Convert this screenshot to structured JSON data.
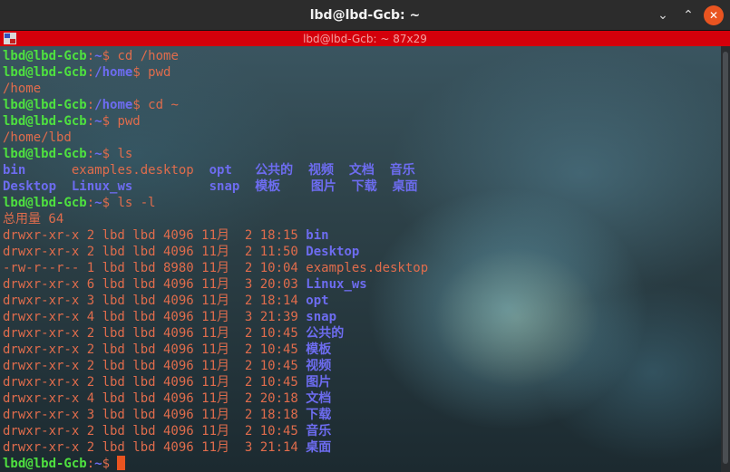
{
  "window": {
    "title": "lbd@lbd-Gcb: ~",
    "terminal_title": "lbd@lbd-Gcb: ~ 87x29"
  },
  "colors": {
    "prompt_user": "#4ee03f",
    "prompt_path": "#6d6cf0",
    "text": "#e06c4c",
    "directory": "#6d6cf0",
    "header_bar": "#d4000b",
    "cursor": "#e95420"
  },
  "terminal": {
    "lines": [
      [
        {
          "t": "lbd@lbd-Gcb",
          "s": "u"
        },
        {
          "t": ":",
          "s": "c"
        },
        {
          "t": "~",
          "s": "p"
        },
        {
          "t": "$ cd /home",
          "s": "c"
        }
      ],
      [
        {
          "t": "lbd@lbd-Gcb",
          "s": "u"
        },
        {
          "t": ":",
          "s": "c"
        },
        {
          "t": "/home",
          "s": "p"
        },
        {
          "t": "$ pwd",
          "s": "c"
        }
      ],
      [
        {
          "t": "/home",
          "s": "c"
        }
      ],
      [
        {
          "t": "lbd@lbd-Gcb",
          "s": "u"
        },
        {
          "t": ":",
          "s": "c"
        },
        {
          "t": "/home",
          "s": "p"
        },
        {
          "t": "$ cd ~",
          "s": "c"
        }
      ],
      [
        {
          "t": "lbd@lbd-Gcb",
          "s": "u"
        },
        {
          "t": ":",
          "s": "c"
        },
        {
          "t": "~",
          "s": "p"
        },
        {
          "t": "$ pwd",
          "s": "c"
        }
      ],
      [
        {
          "t": "/home/lbd",
          "s": "c"
        }
      ],
      [
        {
          "t": "lbd@lbd-Gcb",
          "s": "u"
        },
        {
          "t": ":",
          "s": "c"
        },
        {
          "t": "~",
          "s": "p"
        },
        {
          "t": "$ ls",
          "s": "c"
        }
      ],
      [
        {
          "t": "bin",
          "s": "d"
        },
        {
          "t": "      ",
          "s": "c"
        },
        {
          "t": "examples.desktop",
          "s": "c"
        },
        {
          "t": "  ",
          "s": "c"
        },
        {
          "t": "opt",
          "s": "d"
        },
        {
          "t": "   ",
          "s": "c"
        },
        {
          "t": "公共的",
          "s": "d"
        },
        {
          "t": "  ",
          "s": "c"
        },
        {
          "t": "视频",
          "s": "d"
        },
        {
          "t": "  ",
          "s": "c"
        },
        {
          "t": "文档",
          "s": "d"
        },
        {
          "t": "  ",
          "s": "c"
        },
        {
          "t": "音乐",
          "s": "d"
        }
      ],
      [
        {
          "t": "Desktop",
          "s": "d"
        },
        {
          "t": "  ",
          "s": "c"
        },
        {
          "t": "Linux_ws",
          "s": "d"
        },
        {
          "t": "          ",
          "s": "c"
        },
        {
          "t": "snap",
          "s": "d"
        },
        {
          "t": "  ",
          "s": "c"
        },
        {
          "t": "模板",
          "s": "d"
        },
        {
          "t": "    ",
          "s": "c"
        },
        {
          "t": "图片",
          "s": "d"
        },
        {
          "t": "  ",
          "s": "c"
        },
        {
          "t": "下载",
          "s": "d"
        },
        {
          "t": "  ",
          "s": "c"
        },
        {
          "t": "桌面",
          "s": "d"
        }
      ],
      [
        {
          "t": "lbd@lbd-Gcb",
          "s": "u"
        },
        {
          "t": ":",
          "s": "c"
        },
        {
          "t": "~",
          "s": "p"
        },
        {
          "t": "$ ls -l",
          "s": "c"
        }
      ],
      [
        {
          "t": "总用量 64",
          "s": "c"
        }
      ],
      [
        {
          "t": "drwxr-xr-x 2 lbd lbd 4096 11月  2 18:15 ",
          "s": "c"
        },
        {
          "t": "bin",
          "s": "d"
        }
      ],
      [
        {
          "t": "drwxr-xr-x 2 lbd lbd 4096 11月  2 11:50 ",
          "s": "c"
        },
        {
          "t": "Desktop",
          "s": "d"
        }
      ],
      [
        {
          "t": "-rw-r--r-- 1 lbd lbd 8980 11月  2 10:04 examples.desktop",
          "s": "c"
        }
      ],
      [
        {
          "t": "drwxr-xr-x 6 lbd lbd 4096 11月  3 20:03 ",
          "s": "c"
        },
        {
          "t": "Linux_ws",
          "s": "d"
        }
      ],
      [
        {
          "t": "drwxr-xr-x 3 lbd lbd 4096 11月  2 18:14 ",
          "s": "c"
        },
        {
          "t": "opt",
          "s": "d"
        }
      ],
      [
        {
          "t": "drwxr-xr-x 4 lbd lbd 4096 11月  3 21:39 ",
          "s": "c"
        },
        {
          "t": "snap",
          "s": "d"
        }
      ],
      [
        {
          "t": "drwxr-xr-x 2 lbd lbd 4096 11月  2 10:45 ",
          "s": "c"
        },
        {
          "t": "公共的",
          "s": "d"
        }
      ],
      [
        {
          "t": "drwxr-xr-x 2 lbd lbd 4096 11月  2 10:45 ",
          "s": "c"
        },
        {
          "t": "模板",
          "s": "d"
        }
      ],
      [
        {
          "t": "drwxr-xr-x 2 lbd lbd 4096 11月  2 10:45 ",
          "s": "c"
        },
        {
          "t": "视频",
          "s": "d"
        }
      ],
      [
        {
          "t": "drwxr-xr-x 2 lbd lbd 4096 11月  2 10:45 ",
          "s": "c"
        },
        {
          "t": "图片",
          "s": "d"
        }
      ],
      [
        {
          "t": "drwxr-xr-x 4 lbd lbd 4096 11月  2 20:18 ",
          "s": "c"
        },
        {
          "t": "文档",
          "s": "d"
        }
      ],
      [
        {
          "t": "drwxr-xr-x 3 lbd lbd 4096 11月  2 18:18 ",
          "s": "c"
        },
        {
          "t": "下载",
          "s": "d"
        }
      ],
      [
        {
          "t": "drwxr-xr-x 2 lbd lbd 4096 11月  2 10:45 ",
          "s": "c"
        },
        {
          "t": "音乐",
          "s": "d"
        }
      ],
      [
        {
          "t": "drwxr-xr-x 2 lbd lbd 4096 11月  3 21:14 ",
          "s": "c"
        },
        {
          "t": "桌面",
          "s": "d"
        }
      ],
      [
        {
          "t": "lbd@lbd-Gcb",
          "s": "u"
        },
        {
          "t": ":",
          "s": "c"
        },
        {
          "t": "~",
          "s": "p"
        },
        {
          "t": "$ ",
          "s": "c"
        }
      ]
    ]
  }
}
